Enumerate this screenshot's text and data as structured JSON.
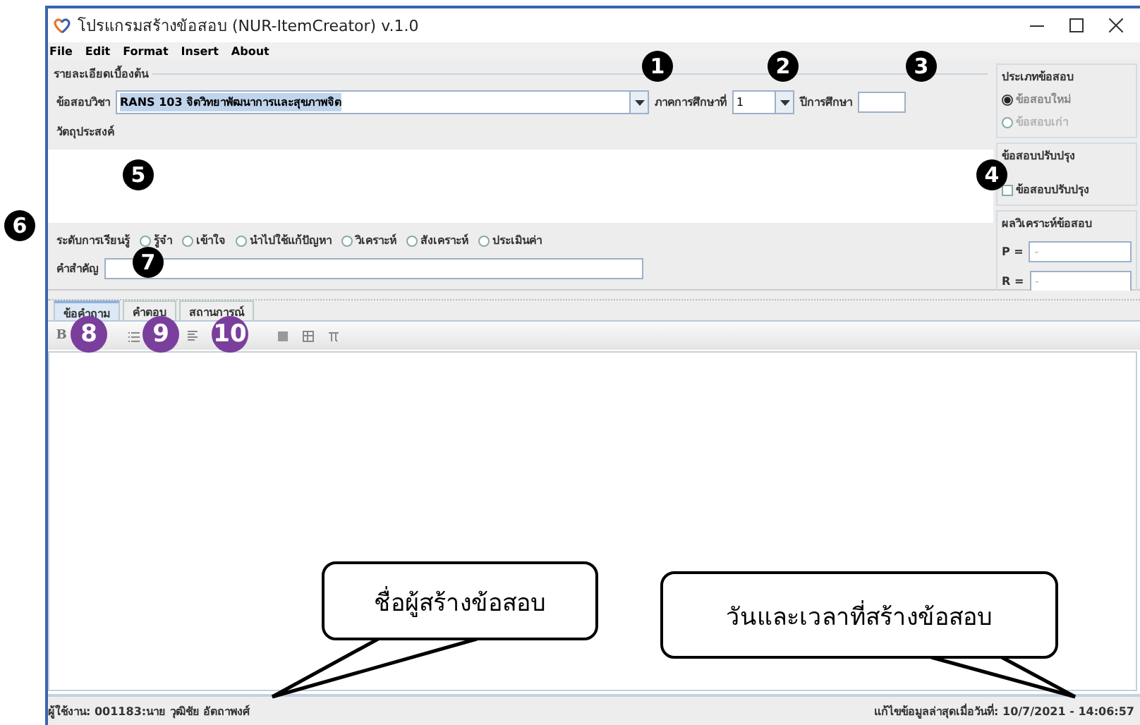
{
  "window": {
    "title": "โปรแกรมสร้างข้อสอบ (NUR-ItemCreator) v.1.0"
  },
  "menu": [
    "File",
    "Edit",
    "Format",
    "Insert",
    "About"
  ],
  "details": {
    "title": "รายละเอียดเบื้องต้น",
    "course_label": "ข้อสอบวิชา",
    "course_value": "RANS 103    จิตวิทยาพัฒนาการและสุขภาพจิต",
    "semester_label": "ภาคการศึกษาที่",
    "semester_value": "1",
    "year_label": "ปีการศึกษา",
    "objective_label": "วัตถุประสงค์"
  },
  "exam_type": {
    "title": "ประเภทข้อสอบ",
    "options": [
      {
        "label": "ข้อสอบใหม่",
        "selected": true,
        "disabled": true
      },
      {
        "label": "ข้อสอบเก่า",
        "selected": false,
        "disabled": true
      }
    ]
  },
  "revised": {
    "title": "ข้อสอบปรับปรุง",
    "label": "ข้อสอบปรับปรุง",
    "checked": false
  },
  "analysis": {
    "title": "ผลวิเคราะห์ข้อสอบ",
    "fields": [
      {
        "label": "P =",
        "value": "-"
      },
      {
        "label": "R =",
        "value": "-"
      }
    ]
  },
  "learning_level": {
    "label": "ระดับการเรียนรู้",
    "options": [
      {
        "label": "รู้จำ",
        "selected": false
      },
      {
        "label": "เข้าใจ",
        "selected": false
      },
      {
        "label": "นำไปใช้แก้ปัญหา",
        "selected": false
      },
      {
        "label": "วิเคราะห์",
        "selected": false
      },
      {
        "label": "สังเคราะห์",
        "selected": false
      },
      {
        "label": "ประเมินค่า",
        "selected": false
      }
    ]
  },
  "keyword": {
    "label": "คำสำคัญ"
  },
  "tabs": [
    {
      "label": "ข้อคำถาม",
      "selected": true
    },
    {
      "label": "คำตอบ",
      "selected": false
    },
    {
      "label": "สถานการณ์",
      "selected": false
    }
  ],
  "toolbar": [
    {
      "kind": "bold",
      "label": "B"
    },
    {
      "kind": "bullets"
    },
    {
      "kind": "align"
    },
    {
      "kind": "image"
    },
    {
      "kind": "table"
    },
    {
      "kind": "formula"
    }
  ],
  "status_bar": {
    "user": "ผู้ใช้งาน: 001183:นาย วุฒิชัย อัตถาพงศ์",
    "modified": "แก้ไขข้อมูลล่าสุดเมื่อวันที่: 10/7/2021 - 14:06:57"
  },
  "callouts": [
    {
      "text": "ชื่อผู้สร้างข้อสอบ"
    },
    {
      "text": "วันและเวลาที่สร้างข้อสอบ"
    }
  ],
  "markers": [
    {
      "label": "1",
      "kind": "black"
    },
    {
      "label": "2",
      "kind": "black"
    },
    {
      "label": "3",
      "kind": "black"
    },
    {
      "label": "4",
      "kind": "black"
    },
    {
      "label": "5",
      "kind": "black"
    },
    {
      "label": "6",
      "kind": "black"
    },
    {
      "label": "7",
      "kind": "black"
    },
    {
      "label": "8",
      "kind": "purple"
    },
    {
      "label": "9",
      "kind": "purple"
    },
    {
      "label": "10",
      "kind": "purple"
    }
  ]
}
